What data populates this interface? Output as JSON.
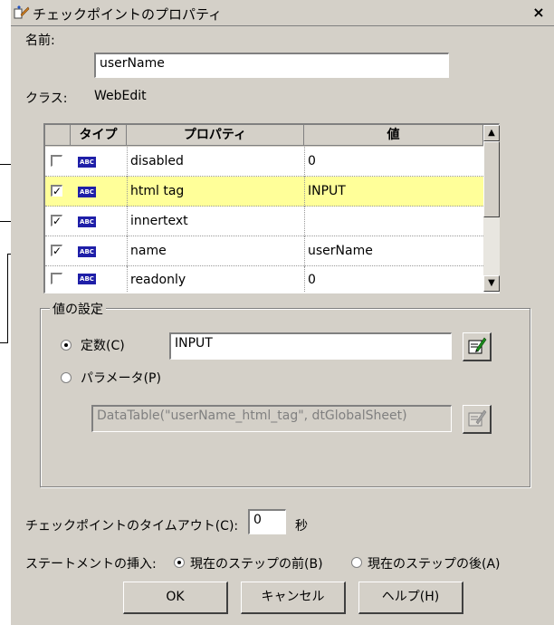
{
  "window": {
    "title": "チェックポイントのプロパティ",
    "close_glyph": "×"
  },
  "name": {
    "label": "名前:",
    "value": "userName"
  },
  "class": {
    "label": "クラス:",
    "value": "WebEdit"
  },
  "grid": {
    "columns": [
      "タイプ",
      "プロパティ",
      "値"
    ],
    "rows": [
      {
        "checked": false,
        "type_icon": "ABC",
        "property": "disabled",
        "value": "0",
        "selected": false
      },
      {
        "checked": true,
        "type_icon": "ABC",
        "property": "html tag",
        "value": "INPUT",
        "selected": true
      },
      {
        "checked": true,
        "type_icon": "ABC",
        "property": "innertext",
        "value": "",
        "selected": false
      },
      {
        "checked": true,
        "type_icon": "ABC",
        "property": "name",
        "value": "userName",
        "selected": false
      },
      {
        "checked": false,
        "type_icon": "ABC",
        "property": "readonly",
        "value": "0",
        "selected": false
      }
    ]
  },
  "value_settings": {
    "legend": "値の設定",
    "constant": {
      "label": "定数(C)",
      "value": "INPUT",
      "selected": true
    },
    "parameter": {
      "label": "パラメータ(P)",
      "value": "DataTable(\"userName_html_tag\", dtGlobalSheet)",
      "selected": false
    }
  },
  "timeout": {
    "label": "チェックポイントのタイムアウト(C):",
    "value": "0",
    "unit": "秒"
  },
  "insert": {
    "label": "ステートメントの挿入:",
    "before": "現在のステップの前(B)",
    "after": "現在のステップの後(A)",
    "selected": "before"
  },
  "buttons": {
    "ok": "OK",
    "cancel": "キャンセル",
    "help": "ヘルプ(H)"
  },
  "colors": {
    "dialog_bg": "#d4d0c8",
    "selected_row": "#ffff99",
    "type_icon_bg": "#1f1fa8"
  },
  "icons": [
    "checkpoint-properties-icon",
    "close-icon",
    "edit-value-icon",
    "scroll-up-icon",
    "scroll-down-icon"
  ]
}
